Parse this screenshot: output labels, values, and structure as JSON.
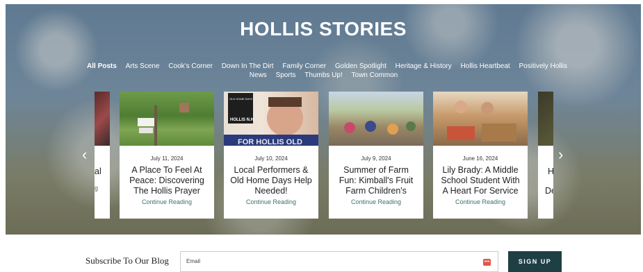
{
  "hero": {
    "title": "HOLLIS STORIES",
    "categories": [
      "All Posts",
      "Arts Scene",
      "Cook's Corner",
      "Down In The Dirt",
      "Family Corner",
      "Golden Spotlight",
      "Heritage & History",
      "Hollis Heartbeat",
      "Positively Hollis News",
      "Sports",
      "Thumbs Up!",
      "Town Common"
    ],
    "active_category": "All Posts",
    "prev_arrow": "‹",
    "next_arrow": "›"
  },
  "partial_left": {
    "title": "al",
    "more": "g"
  },
  "partial_right": {
    "title_line1": "H",
    "title_line2": "De"
  },
  "posts": [
    {
      "date": "July 11, 2024",
      "title": "A Place To Feel At Peace: Discovering The Hollis Prayer",
      "more": "Continue Reading"
    },
    {
      "date": "July 10, 2024",
      "title": "Local Performers & Old Home Days Help Needed!",
      "more": "Continue Reading",
      "image_text_top": "OLD HOME DAYS",
      "image_text_mid": "HOLLIS N.H.",
      "image_text_bottom": "FOR HOLLIS OLD"
    },
    {
      "date": "July 9, 2024",
      "title": "Summer of Farm Fun: Kimball's Fruit Farm Children's",
      "more": "Continue Reading"
    },
    {
      "date": "June 16, 2024",
      "title": "Lily Brady: A Middle School Student With A Heart For Service",
      "more": "Continue Reading"
    }
  ],
  "subscribe": {
    "heading": "Subscribe To Our Blog",
    "email_label": "Email",
    "button": "SIGN UP"
  }
}
